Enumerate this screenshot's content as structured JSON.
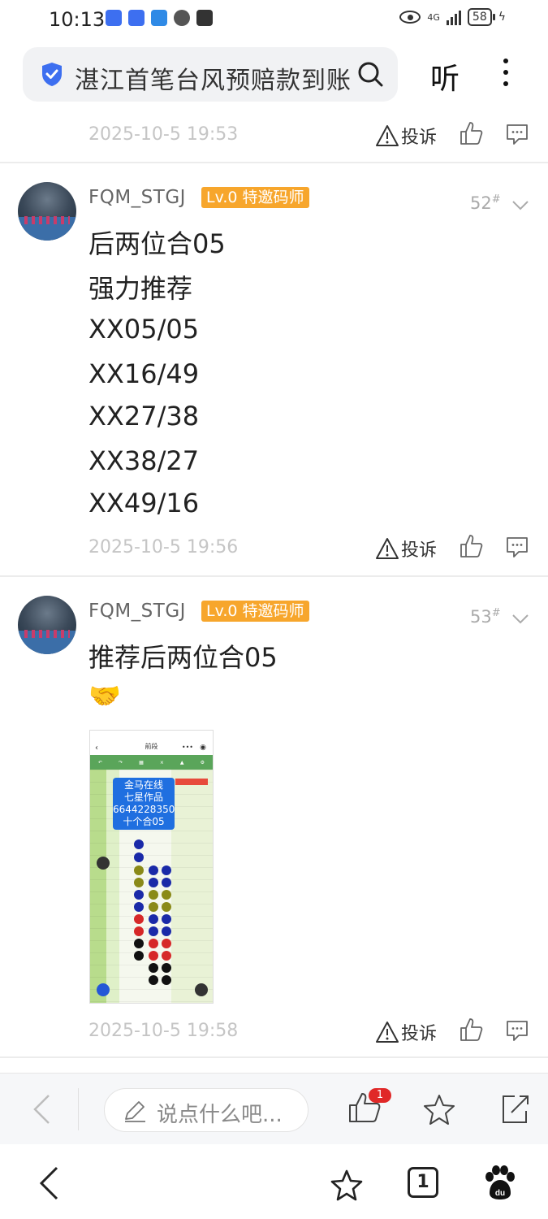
{
  "status_bar": {
    "time": "10:13",
    "network": "4G",
    "battery": "58"
  },
  "search_bar": {
    "query": "湛江首笔台风预赔款到账",
    "listen_label": "听"
  },
  "prev_reply": {
    "time": "2025-10-5 19:53",
    "report_label": "投诉"
  },
  "replies": [
    {
      "username": "FQM_STGJ",
      "badge": "Lv.0 特邀码师",
      "floor": "52",
      "floor_mark": "#",
      "lines": [
        "后两位合05",
        "强力推荐",
        "XX05/05",
        "XX16/49",
        "XX27/38",
        "XX38/27",
        "XX49/16"
      ],
      "time": "2025-10-5 19:56",
      "report_label": "投诉"
    },
    {
      "username": "FQM_STGJ",
      "badge": "Lv.0 特邀码师",
      "floor": "53",
      "floor_mark": "#",
      "lines": [
        "推荐后两位合05"
      ],
      "emoji": "🤝",
      "image": {
        "nav_title": "前段",
        "popup_lines": [
          "金马在线",
          "七星作品",
          "6644228350",
          "十个合05"
        ]
      },
      "time": "2025-10-5 19:58",
      "report_label": "投诉"
    }
  ],
  "comment_bar": {
    "placeholder": "说点什么吧...",
    "like_count": "1"
  },
  "sys_nav": {
    "tabs_count": "1"
  },
  "colors": {
    "badge": "#f7a62c",
    "accent_blue": "#3d6ff0",
    "like_badge": "#e02828"
  }
}
